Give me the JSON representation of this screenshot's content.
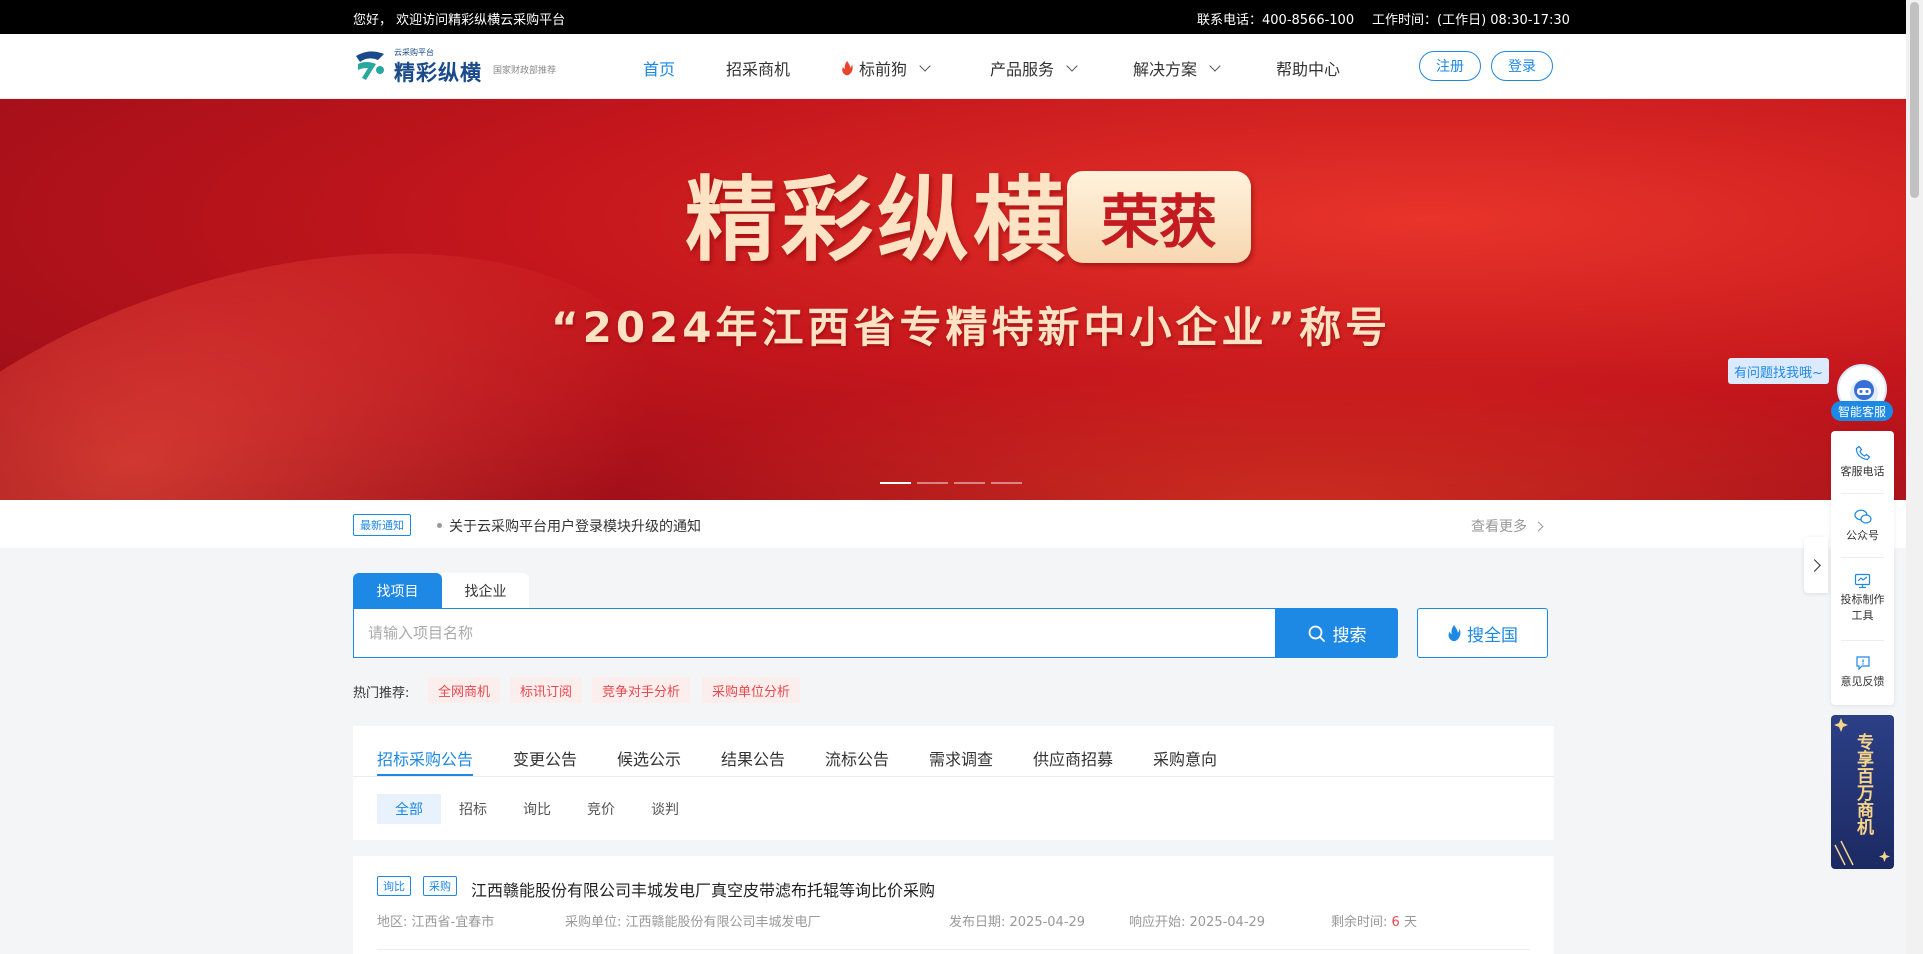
{
  "topbar": {
    "greeting": "您好， 欢迎访问精彩纵横云采购平台",
    "phone": "联系电话：400-8566-100",
    "hours": "工作时间：(工作日) 08:30-17:30"
  },
  "logo": {
    "small": "云采购平台",
    "name": "精彩纵横",
    "sub": "国家财政部推荐"
  },
  "nav": {
    "items": [
      "首页",
      "招采商机",
      "标前狗",
      "产品服务",
      "解决方案",
      "帮助中心"
    ],
    "register": "注册",
    "login": "登录"
  },
  "banner": {
    "title": "精彩纵横",
    "badge": "荣获",
    "subtitle": "“2024年江西省专精特新中小企业”称号",
    "slide_count": 4,
    "active_slide": 1
  },
  "notice": {
    "tag": "最新通知",
    "text": "关于云采购平台用户登录模块升级的通知",
    "more": "查看更多"
  },
  "search": {
    "tab_project": "找项目",
    "tab_enterprise": "找企业",
    "placeholder": "请输入项目名称",
    "button": "搜索",
    "all_button": "搜全国",
    "hot_label": "热门推荐:",
    "hot_tags": [
      "全网商机",
      "标讯订阅",
      "竞争对手分析",
      "采购单位分析"
    ]
  },
  "categories": {
    "tabs": [
      "招标采购公告",
      "变更公告",
      "候选公示",
      "结果公告",
      "流标公告",
      "需求调查",
      "供应商招募",
      "采购意向"
    ],
    "sub_tabs": [
      "全部",
      "招标",
      "询比",
      "竞价",
      "谈判"
    ]
  },
  "list": [
    {
      "tags": [
        "询比",
        "采购"
      ],
      "title": "江西赣能股份有限公司丰城发电厂真空皮带滤布托辊等询比价采购",
      "region": "地区: 江西省-宜春市",
      "buyer": "采购单位: 江西赣能股份有限公司丰城发电厂",
      "publish": "发布日期: 2025-04-29",
      "response": "响应开始: 2025-04-29",
      "remaining_label": "剩余时间:",
      "remaining_value": "6",
      "remaining_unit": "天"
    }
  ],
  "side": {
    "bubble": "有问题找我哦~",
    "smart": "智能客服",
    "items": [
      "客服电话",
      "公众号",
      "投标制作工具",
      "意见反馈"
    ],
    "promo": "专享百万商机"
  },
  "colors": {
    "accent": "#1e88e5",
    "banner_red": "#c4161c",
    "tag_red": "#e5484d"
  }
}
